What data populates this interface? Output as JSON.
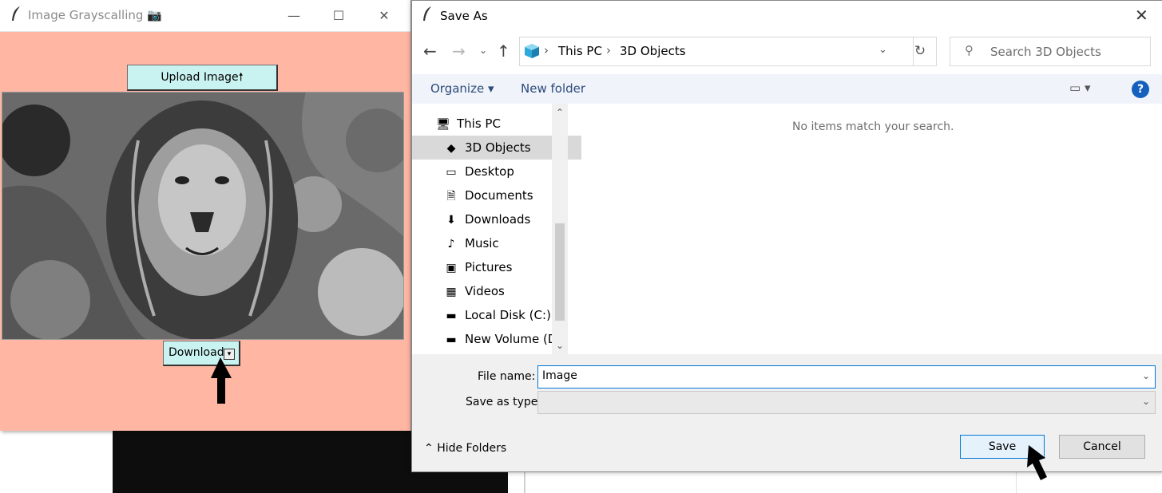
{
  "app": {
    "title": "Image Grayscalling 📷",
    "upload_label": "Upload Image🠕",
    "download_label": "Download",
    "download_arrow": "▾"
  },
  "dialog": {
    "title": "Save As",
    "breadcrumb": [
      "This PC",
      "3D Objects"
    ],
    "search_placeholder": "Search 3D Objects",
    "toolbar": {
      "organize": "Organize ▾",
      "new_folder": "New folder",
      "help": "?"
    },
    "nav_items": [
      {
        "label": "This PC",
        "icon": "computer-icon",
        "glyph": "🖥",
        "selected": false,
        "indent": 0
      },
      {
        "label": "3D Objects",
        "icon": "cube-icon",
        "glyph": "◆",
        "selected": true,
        "indent": 1
      },
      {
        "label": "Desktop",
        "icon": "desktop-icon",
        "glyph": "▭",
        "selected": false,
        "indent": 1
      },
      {
        "label": "Documents",
        "icon": "documents-icon",
        "glyph": "🗎",
        "selected": false,
        "indent": 1
      },
      {
        "label": "Downloads",
        "icon": "downloads-icon",
        "glyph": "⬇",
        "selected": false,
        "indent": 1
      },
      {
        "label": "Music",
        "icon": "music-icon",
        "glyph": "♪",
        "selected": false,
        "indent": 1
      },
      {
        "label": "Pictures",
        "icon": "pictures-icon",
        "glyph": "▣",
        "selected": false,
        "indent": 1
      },
      {
        "label": "Videos",
        "icon": "videos-icon",
        "glyph": "▦",
        "selected": false,
        "indent": 1
      },
      {
        "label": "Local Disk (C:)",
        "icon": "disk-icon",
        "glyph": "▬",
        "selected": false,
        "indent": 1
      },
      {
        "label": "New Volume (D:)",
        "icon": "drive-icon",
        "glyph": "▬",
        "selected": false,
        "indent": 1
      }
    ],
    "empty_message": "No items match your search.",
    "file_name_label": "File name:",
    "file_name_value": "Image",
    "save_as_type_label": "Save as type:",
    "save_as_type_value": "",
    "hide_folders": "Hide Folders",
    "save_label": "Save",
    "cancel_label": "Cancel"
  }
}
